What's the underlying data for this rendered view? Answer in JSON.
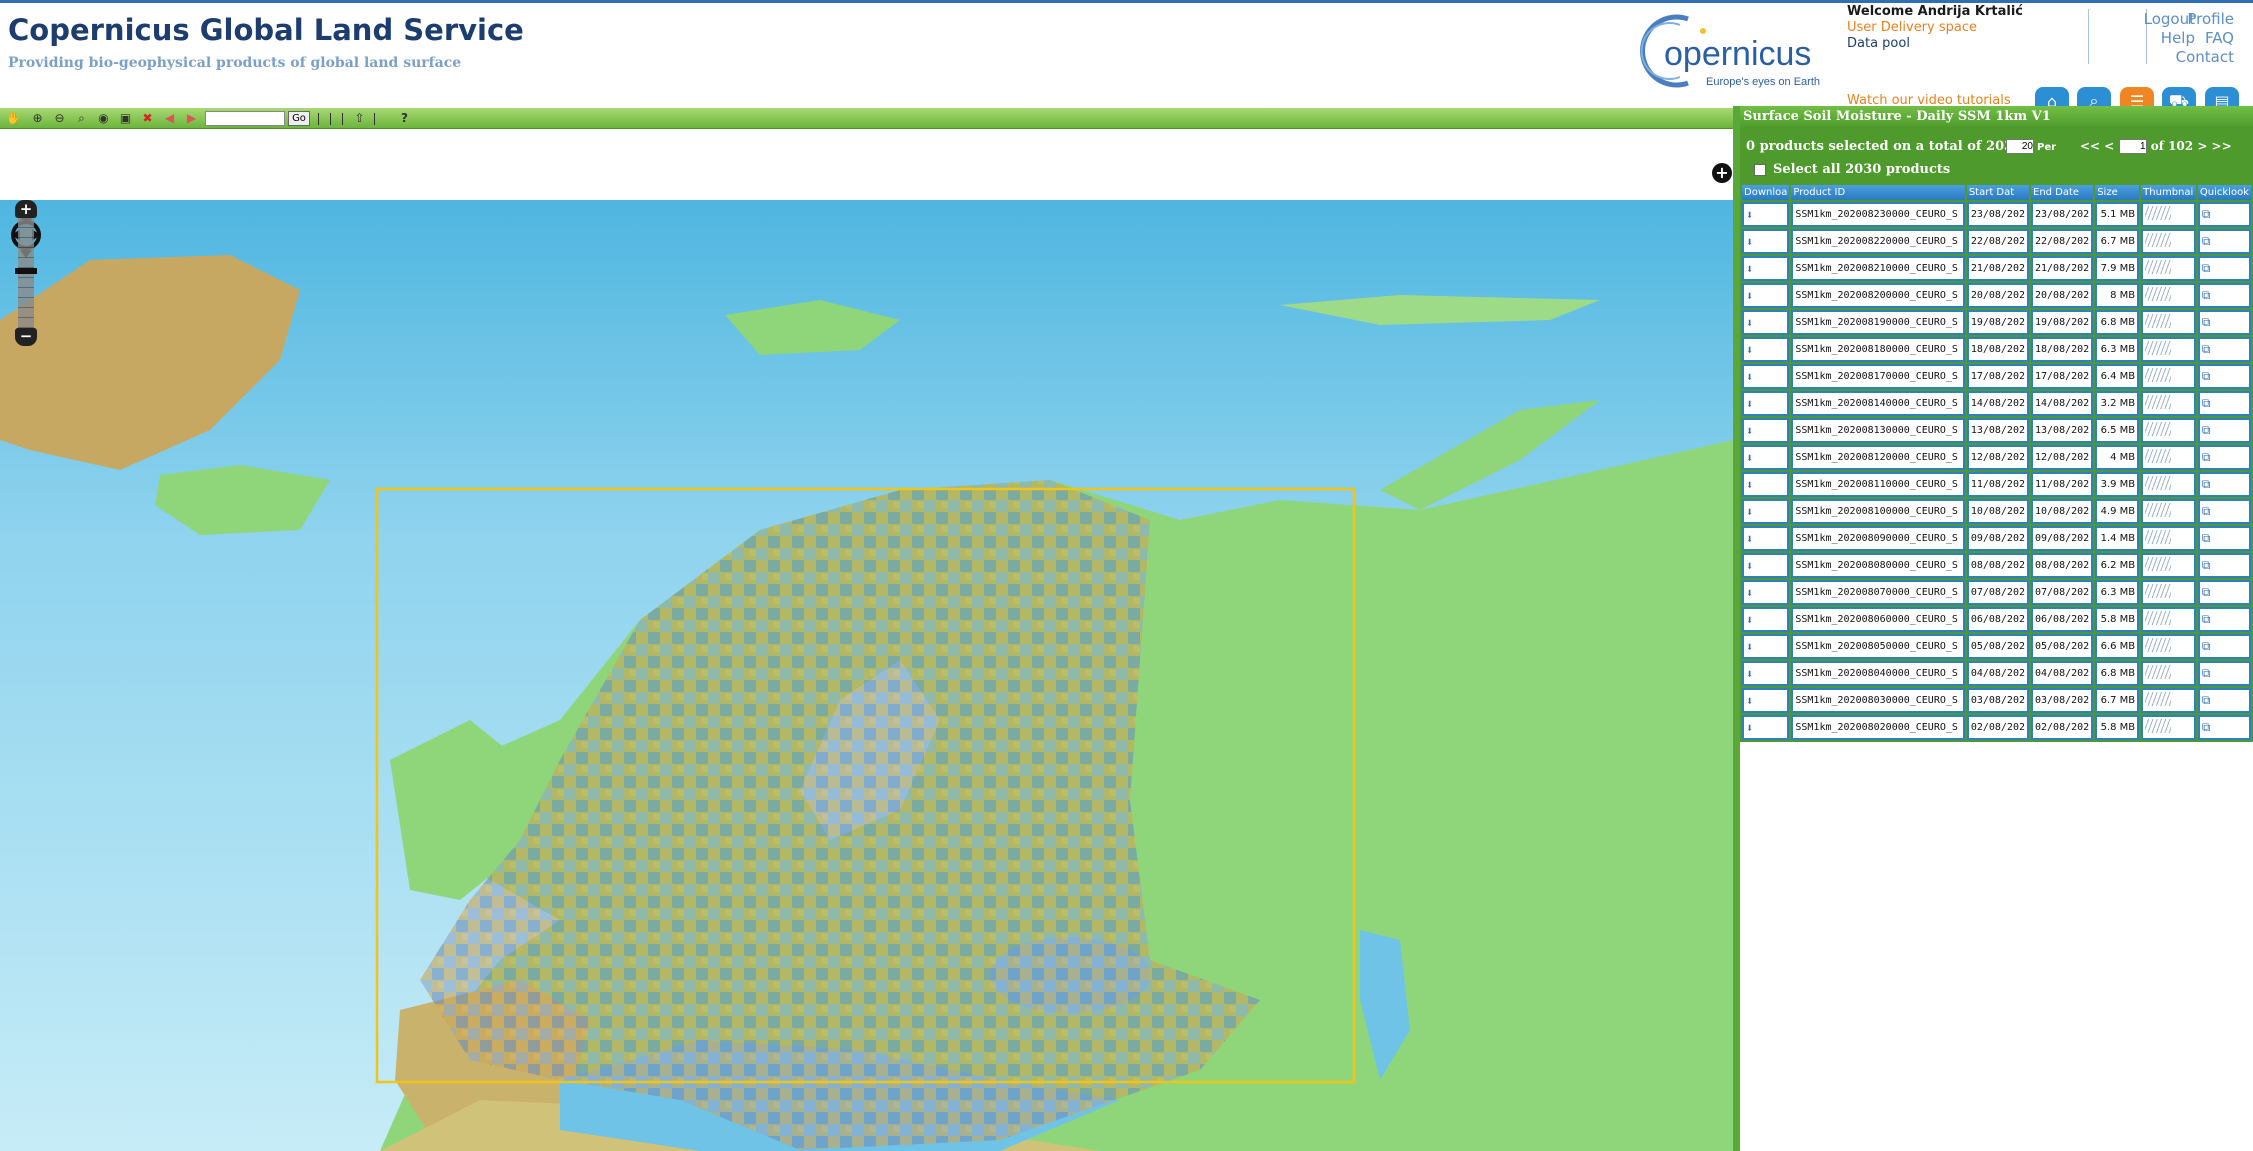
{
  "header": {
    "title": "Copernicus Global Land Service",
    "subtitle": "Providing bio-geophysical products of global land surface",
    "logo_text": "opernicus",
    "logo_tagline": "Europe's eyes on Earth",
    "welcome": "Welcome Andrija Krtalić",
    "user_delivery_space": "User Delivery space",
    "data_pool": "Data pool",
    "video_tutorials": "Watch our video tutorials",
    "links": {
      "logout": "Logout",
      "help": "Help",
      "profile": "Profile",
      "faq": "FAQ",
      "contact": "Contact"
    },
    "nav_icons": [
      "home-icon",
      "search-icon",
      "list-icon",
      "cart-icon",
      "document-icon"
    ]
  },
  "toolbar": {
    "go_label": "Go",
    "help_label": "?",
    "search_value": ""
  },
  "map": {
    "layer_switcher_label": "+",
    "zoom_in_label": "+",
    "zoom_out_label": "−"
  },
  "panel": {
    "title": "Surface Soil Moisture - Daily SSM 1km V1",
    "summary": "0 products selected on a total of 2030",
    "per_page": "20",
    "per_label": "Per",
    "pager_prev": "<< <",
    "current_page": "1",
    "pager_of": "of  102",
    "pager_next": "> >>",
    "select_all": "Select all 2030 products",
    "columns": [
      "Downloa",
      "Product ID",
      "Start Dat",
      "End Date",
      "Size",
      "Thumbnai",
      "Quicklook"
    ],
    "rows": [
      {
        "id": "SSM1km_202008230000_CEURO_S",
        "start": "23/08/202",
        "end": "23/08/202",
        "size": "5.1 MB"
      },
      {
        "id": "SSM1km_202008220000_CEURO_S",
        "start": "22/08/202",
        "end": "22/08/202",
        "size": "6.7 MB"
      },
      {
        "id": "SSM1km_202008210000_CEURO_S",
        "start": "21/08/202",
        "end": "21/08/202",
        "size": "7.9 MB"
      },
      {
        "id": "SSM1km_202008200000_CEURO_S",
        "start": "20/08/202",
        "end": "20/08/202",
        "size": "8 MB"
      },
      {
        "id": "SSM1km_202008190000_CEURO_S",
        "start": "19/08/202",
        "end": "19/08/202",
        "size": "6.8 MB"
      },
      {
        "id": "SSM1km_202008180000_CEURO_S",
        "start": "18/08/202",
        "end": "18/08/202",
        "size": "6.3 MB"
      },
      {
        "id": "SSM1km_202008170000_CEURO_S",
        "start": "17/08/202",
        "end": "17/08/202",
        "size": "6.4 MB"
      },
      {
        "id": "SSM1km_202008140000_CEURO_S",
        "start": "14/08/202",
        "end": "14/08/202",
        "size": "3.2 MB"
      },
      {
        "id": "SSM1km_202008130000_CEURO_S",
        "start": "13/08/202",
        "end": "13/08/202",
        "size": "6.5 MB"
      },
      {
        "id": "SSM1km_202008120000_CEURO_S",
        "start": "12/08/202",
        "end": "12/08/202",
        "size": "4 MB"
      },
      {
        "id": "SSM1km_202008110000_CEURO_S",
        "start": "11/08/202",
        "end": "11/08/202",
        "size": "3.9 MB"
      },
      {
        "id": "SSM1km_202008100000_CEURO_S",
        "start": "10/08/202",
        "end": "10/08/202",
        "size": "4.9 MB"
      },
      {
        "id": "SSM1km_202008090000_CEURO_S",
        "start": "09/08/202",
        "end": "09/08/202",
        "size": "1.4 MB"
      },
      {
        "id": "SSM1km_202008080000_CEURO_S",
        "start": "08/08/202",
        "end": "08/08/202",
        "size": "6.2 MB"
      },
      {
        "id": "SSM1km_202008070000_CEURO_S",
        "start": "07/08/202",
        "end": "07/08/202",
        "size": "6.3 MB"
      },
      {
        "id": "SSM1km_202008060000_CEURO_S",
        "start": "06/08/202",
        "end": "06/08/202",
        "size": "5.8 MB"
      },
      {
        "id": "SSM1km_202008050000_CEURO_S",
        "start": "05/08/202",
        "end": "05/08/202",
        "size": "6.6 MB"
      },
      {
        "id": "SSM1km_202008040000_CEURO_S",
        "start": "04/08/202",
        "end": "04/08/202",
        "size": "6.8 MB"
      },
      {
        "id": "SSM1km_202008030000_CEURO_S",
        "start": "03/08/202",
        "end": "03/08/202",
        "size": "6.7 MB"
      },
      {
        "id": "SSM1km_202008020000_CEURO_S",
        "start": "02/08/202",
        "end": "02/08/202",
        "size": "5.8 MB"
      }
    ]
  },
  "colors": {
    "brand_blue": "#1d3d6e",
    "accent_orange": "#e8821e",
    "panel_green": "#4f9a2c",
    "table_blue": "#2f7fc3",
    "ocean": "#bfe8f5",
    "land": "#8fd67a",
    "aoi_box": "#f0c419"
  }
}
